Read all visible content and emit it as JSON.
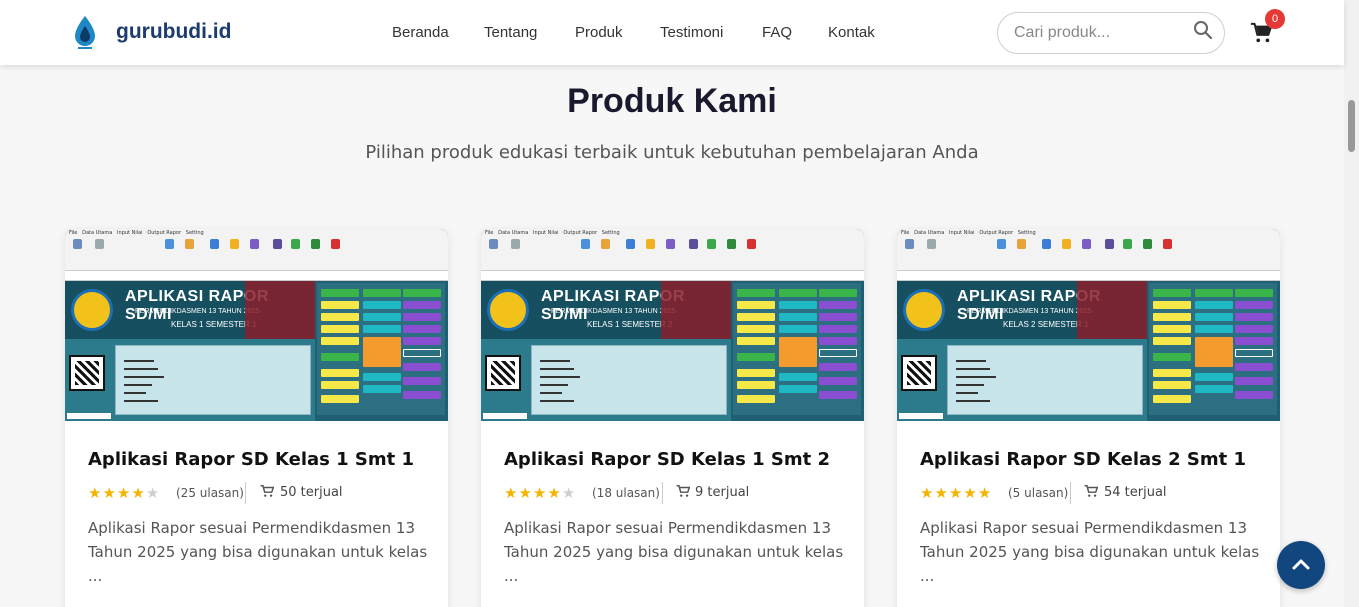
{
  "brand": {
    "name": "gurubudi.id"
  },
  "nav": [
    "Beranda",
    "Tentang",
    "Produk",
    "Testimoni",
    "FAQ",
    "Kontak"
  ],
  "search": {
    "placeholder": "Cari produk...",
    "icon": "search-icon"
  },
  "cart": {
    "count": "0",
    "icon": "cart-icon"
  },
  "section": {
    "title": "Produk Kami",
    "subtitle": "Pilihan produk edukasi terbaik untuk kebutuhan pembelajaran Anda"
  },
  "products": [
    {
      "title": "Aplikasi Rapor SD Kelas 1 Smt 1",
      "rating": 4,
      "reviews": "(25 ulasan)",
      "sold": "50 terjual",
      "description": "Aplikasi Rapor sesuai Permendikdasmen 13 Tahun 2025 yang bisa digunakan untuk kelas ...",
      "thumb": {
        "app_title": "APLIKASI RAPOR SD/MI",
        "app_sub": "PERMENDIKDASMEN 13 TAHUN 2025",
        "class_label": "KELAS 1 SEMESTER 1"
      }
    },
    {
      "title": "Aplikasi Rapor SD Kelas 1 Smt 2",
      "rating": 4,
      "reviews": "(18 ulasan)",
      "sold": "9 terjual",
      "description": "Aplikasi Rapor sesuai Permendikdasmen 13 Tahun 2025 yang bisa digunakan untuk kelas ...",
      "thumb": {
        "app_title": "APLIKASI RAPOR SD/MI",
        "app_sub": "PERMENDIKDASMEN 13 TAHUN 2025",
        "class_label": "KELAS 1 SEMESTER 2"
      }
    },
    {
      "title": "Aplikasi Rapor SD Kelas 2 Smt 1",
      "rating": 5,
      "reviews": "(5 ulasan)",
      "sold": "54 terjual",
      "description": "Aplikasi Rapor sesuai Permendikdasmen 13 Tahun 2025 yang bisa digunakan untuk kelas ...",
      "thumb": {
        "app_title": "APLIKASI RAPOR SD/MI",
        "app_sub": "PERMENDIKDASMEN 13 TAHUN 2025",
        "class_label": "KELAS 2 SEMESTER 1"
      }
    }
  ],
  "colors": {
    "brand": "#1d3b6e",
    "star": "#f5b400",
    "badge": "#e53935",
    "scroll_top_button": "#12467f"
  },
  "scroll_top": {
    "icon": "chevron-up-icon"
  }
}
